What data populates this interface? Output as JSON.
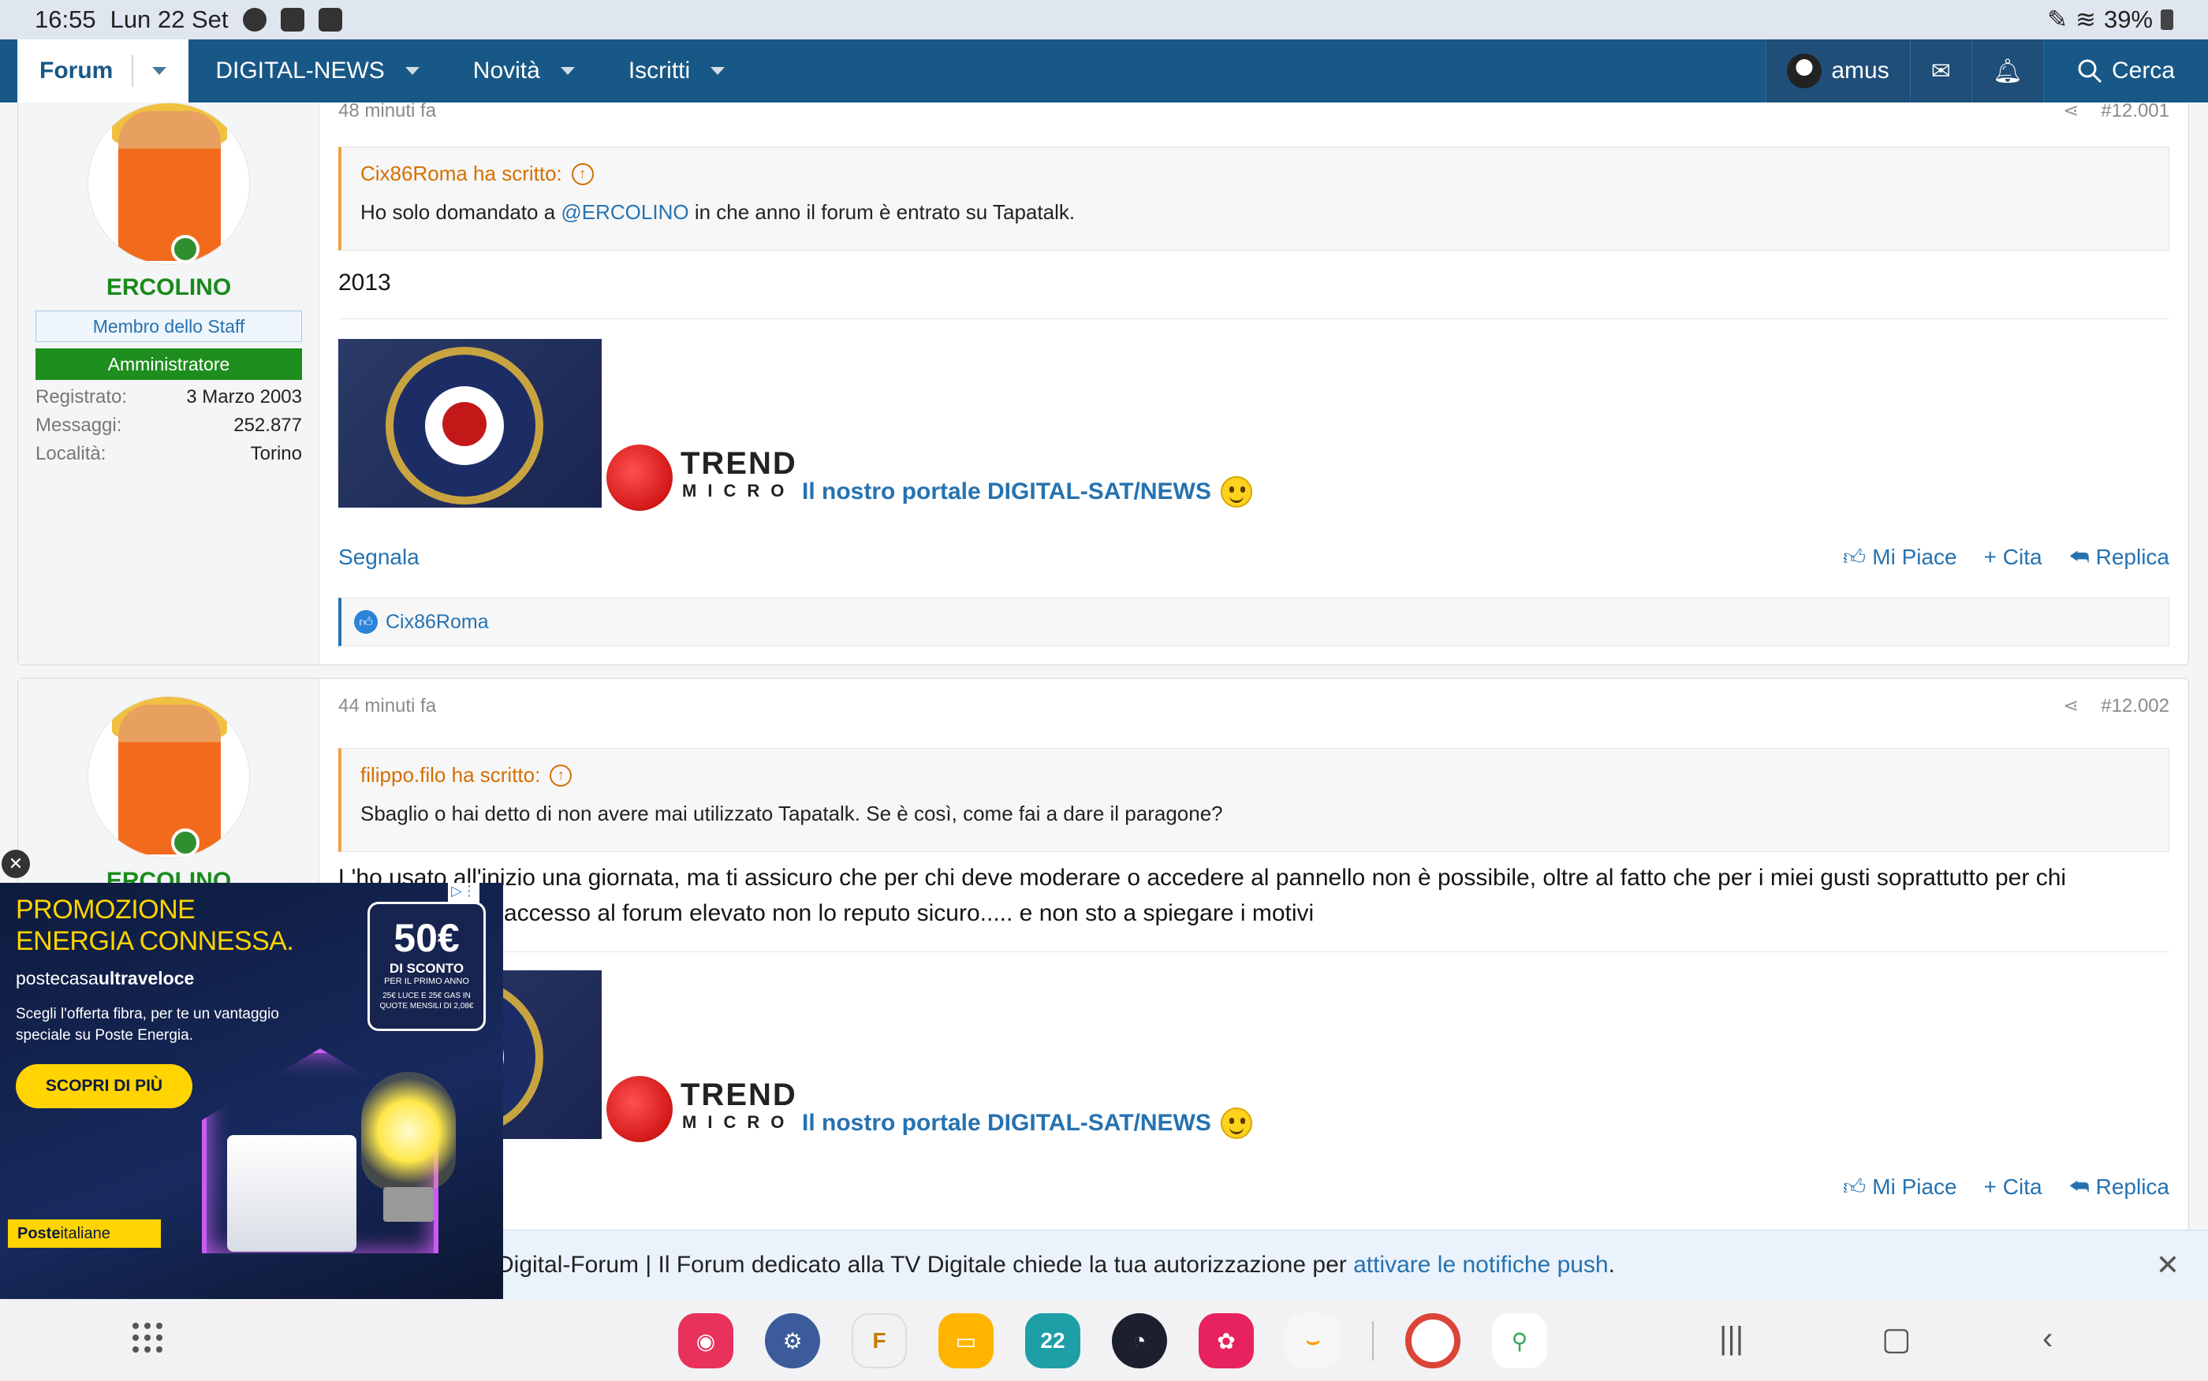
{
  "status_bar": {
    "time": "16:55",
    "date": "Lun 22 Set",
    "battery": "39%"
  },
  "nav": {
    "active_tab": "Forum",
    "items": [
      "DIGITAL-NEWS",
      "Novità",
      "Iscritti"
    ],
    "user": "amus",
    "search_label": "Cerca"
  },
  "posts": [
    {
      "time": "48 minuti fa",
      "number": "#12.001",
      "username": "ERCOLINO",
      "badge_staff": "Membro dello Staff",
      "badge_admin": "Amministratore",
      "stats": [
        {
          "k": "Registrato:",
          "v": "3 Marzo 2003"
        },
        {
          "k": "Messaggi:",
          "v": "252.877"
        },
        {
          "k": "Località:",
          "v": "Torino"
        }
      ],
      "quote_author": "Cix86Roma ha scritto:",
      "quote_pre": "Ho solo domandato a ",
      "quote_mention": "@ERCOLINO",
      "quote_post": " in che anno il forum è entrato su Tapatalk.",
      "message": "2013",
      "signature_link": "Il nostro portale DIGITAL-SAT/NEWS",
      "report": "Segnala",
      "like": "Mi Piace",
      "quote_action": "+ Cita",
      "reply": "Replica",
      "reaction_user": "Cix86Roma"
    },
    {
      "time": "44 minuti fa",
      "number": "#12.002",
      "username": "ERCOLINO",
      "quote_author": "filippo.filo ha scritto:",
      "quote_text": "Sbaglio o hai detto di non avere mai utilizzato Tapatalk. Se è così, come fai a dare il paragone?",
      "message_line1": "L'ho usato all'inizio una giornata, ma ti assicuro che per chi deve moderare o accedere al pannello non è possibile, oltre al fatto che per i miei gusti soprattutto per chi",
      "message_line2": "accesso al forum elevato non lo reputo sicuro..... e non sto a spiegare i motivi",
      "signature_link": "Il nostro portale DIGITAL-SAT/NEWS",
      "like": "Mi Piace",
      "quote_action": "+ Cita",
      "reply": "Replica"
    }
  ],
  "trend": {
    "line1": "TREND",
    "line2": "MICRO"
  },
  "push": {
    "text": "Digital-Forum | Il Forum dedicato alla TV Digitale chiede la tua autorizzazione per ",
    "link": "attivare le notifiche push",
    "end": "."
  },
  "ad": {
    "headline1": "PROMOZIONE",
    "headline2": "ENERGIA CONNESSA.",
    "brand_pre": "postecasa",
    "brand_bold": "ultraveloce",
    "desc": "Scegli l'offerta fibra, per te un vantaggio speciale su Poste Energia.",
    "cta": "SCOPRI DI PIÙ",
    "badge_big": "50€",
    "badge_s1": "DI SCONTO",
    "badge_s2": "PER IL PRIMO ANNO",
    "badge_s3": "25€ LUCE E 25€ GAS IN QUOTE MENSILI DI 2,08€",
    "poste_bold": "Poste",
    "poste_rest": "italiane"
  },
  "colors": {
    "nav_bg": "#185886",
    "link": "#2672b0",
    "staff_green": "#1e8e1e",
    "quote_accent": "#d46f00"
  }
}
